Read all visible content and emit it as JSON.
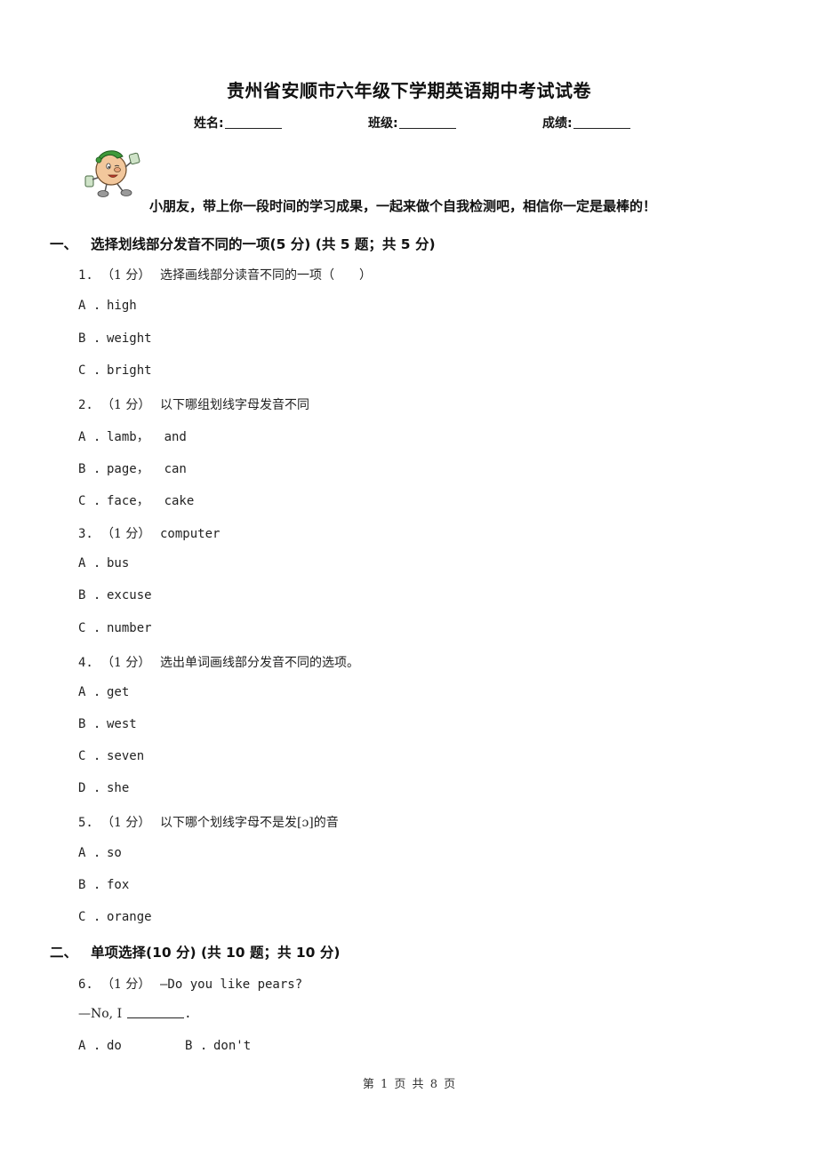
{
  "header": {
    "title": "贵州省安顺市六年级下学期英语期中考试试卷",
    "fields": [
      {
        "label": "姓名:"
      },
      {
        "label": "班级:"
      },
      {
        "label": "成绩:"
      }
    ],
    "mascot_icon": "cartoon-mascot-icon",
    "greeting": "小朋友，带上你一段时间的学习成果，一起来做个自我检测吧，相信你一定是最棒的！"
  },
  "sections": [
    {
      "number": "一、",
      "title": "选择划线部分发音不同的一项(5 分) (共 5 题；共 5 分)",
      "questions": [
        {
          "number": "1.",
          "score": "（1 分）",
          "text": "选择画线部分读音不同的一项（　　）",
          "options": [
            {
              "letter": "A .",
              "text": "high"
            },
            {
              "letter": "B .",
              "text": "weight"
            },
            {
              "letter": "C .",
              "text": "bright"
            }
          ]
        },
        {
          "number": "2.",
          "score": "（1 分）",
          "text": "以下哪组划线字母发音不同",
          "options": [
            {
              "letter": "A .",
              "text": "lamb，  and"
            },
            {
              "letter": "B .",
              "text": "page，  can"
            },
            {
              "letter": "C .",
              "text": "face，  cake"
            }
          ]
        },
        {
          "number": "3.",
          "score": "（1 分）",
          "text": "computer",
          "options": [
            {
              "letter": "A .",
              "text": "bus"
            },
            {
              "letter": "B .",
              "text": "excuse"
            },
            {
              "letter": "C .",
              "text": "number"
            }
          ]
        },
        {
          "number": "4.",
          "score": "（1 分）",
          "text": "选出单词画线部分发音不同的选项。",
          "options": [
            {
              "letter": "A .",
              "text": "get"
            },
            {
              "letter": "B .",
              "text": "west"
            },
            {
              "letter": "C .",
              "text": "seven"
            },
            {
              "letter": "D .",
              "text": "she"
            }
          ]
        },
        {
          "number": "5.",
          "score": "（1 分）",
          "text": "以下哪个划线字母不是发[ɔ]的音",
          "options": [
            {
              "letter": "A .",
              "text": "so"
            },
            {
              "letter": "B .",
              "text": "fox"
            },
            {
              "letter": "C .",
              "text": "orange"
            }
          ]
        }
      ]
    },
    {
      "number": "二、",
      "title": "单项选择(10 分) (共 10 题；共 10 分)",
      "questions": [
        {
          "number": "6.",
          "score": "（1 分）",
          "text": "—Do you like pears?",
          "answer_line_prefix": "—No, I",
          "answer_line_suffix": ".",
          "options": [
            {
              "letter": "A .",
              "text": "do"
            },
            {
              "letter": "B .",
              "text": "don't"
            }
          ]
        }
      ]
    }
  ],
  "footer": {
    "page_label": "第 1 页 共 8 页"
  }
}
